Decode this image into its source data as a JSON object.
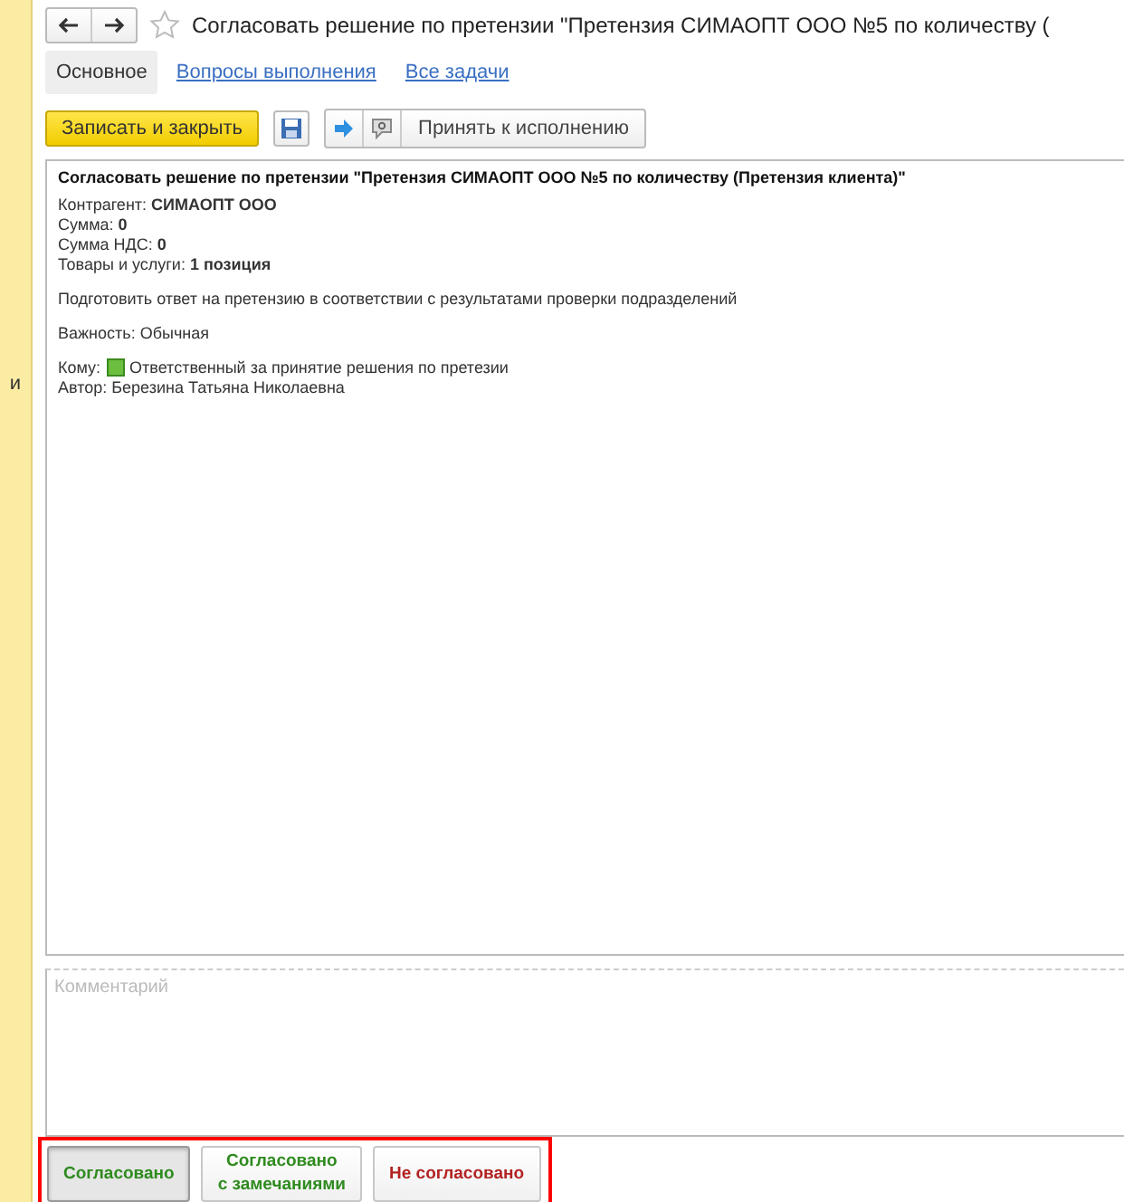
{
  "sidebar": {
    "text": "и"
  },
  "window": {
    "title": "Согласовать решение по претензии \"Претензия СИМАОПТ ООО №5 по количеству ("
  },
  "tabs": [
    {
      "label": "Основное",
      "selected": true
    },
    {
      "label": "Вопросы выполнения",
      "selected": false
    },
    {
      "label": "Все задачи",
      "selected": false
    }
  ],
  "toolbar": {
    "save_close": "Записать и закрыть",
    "accept": "Принять к исполнению"
  },
  "task": {
    "heading": "Согласовать решение по претензии \"Претензия СИМАОПТ ООО №5 по количеству (Претензия клиента)\"",
    "fields": [
      "Контрагент: **СИМАОПТ ООО**",
      "Сумма: **0**",
      "Сумма НДС: **0**",
      "Товары и услуги: **1 позиция**"
    ],
    "description": "Подготовить ответ на претензию в соответствии с результатами проверки подразделений",
    "importance": "Важность: Обычная",
    "to_label": "Кому:",
    "to_value": "Ответственный за принятие решения по претезии",
    "author": "Автор: Березина Татьяна Николаевна"
  },
  "comment": {
    "placeholder": "Комментарий"
  },
  "decisions": [
    {
      "label": "Согласовано",
      "selected": true,
      "color": "#2e8b1e"
    },
    {
      "label": "Согласовано\nс замечаниями",
      "selected": false,
      "color": "#2e8b1e"
    },
    {
      "label": "Не согласовано",
      "selected": false,
      "color": "#b22222"
    }
  ]
}
